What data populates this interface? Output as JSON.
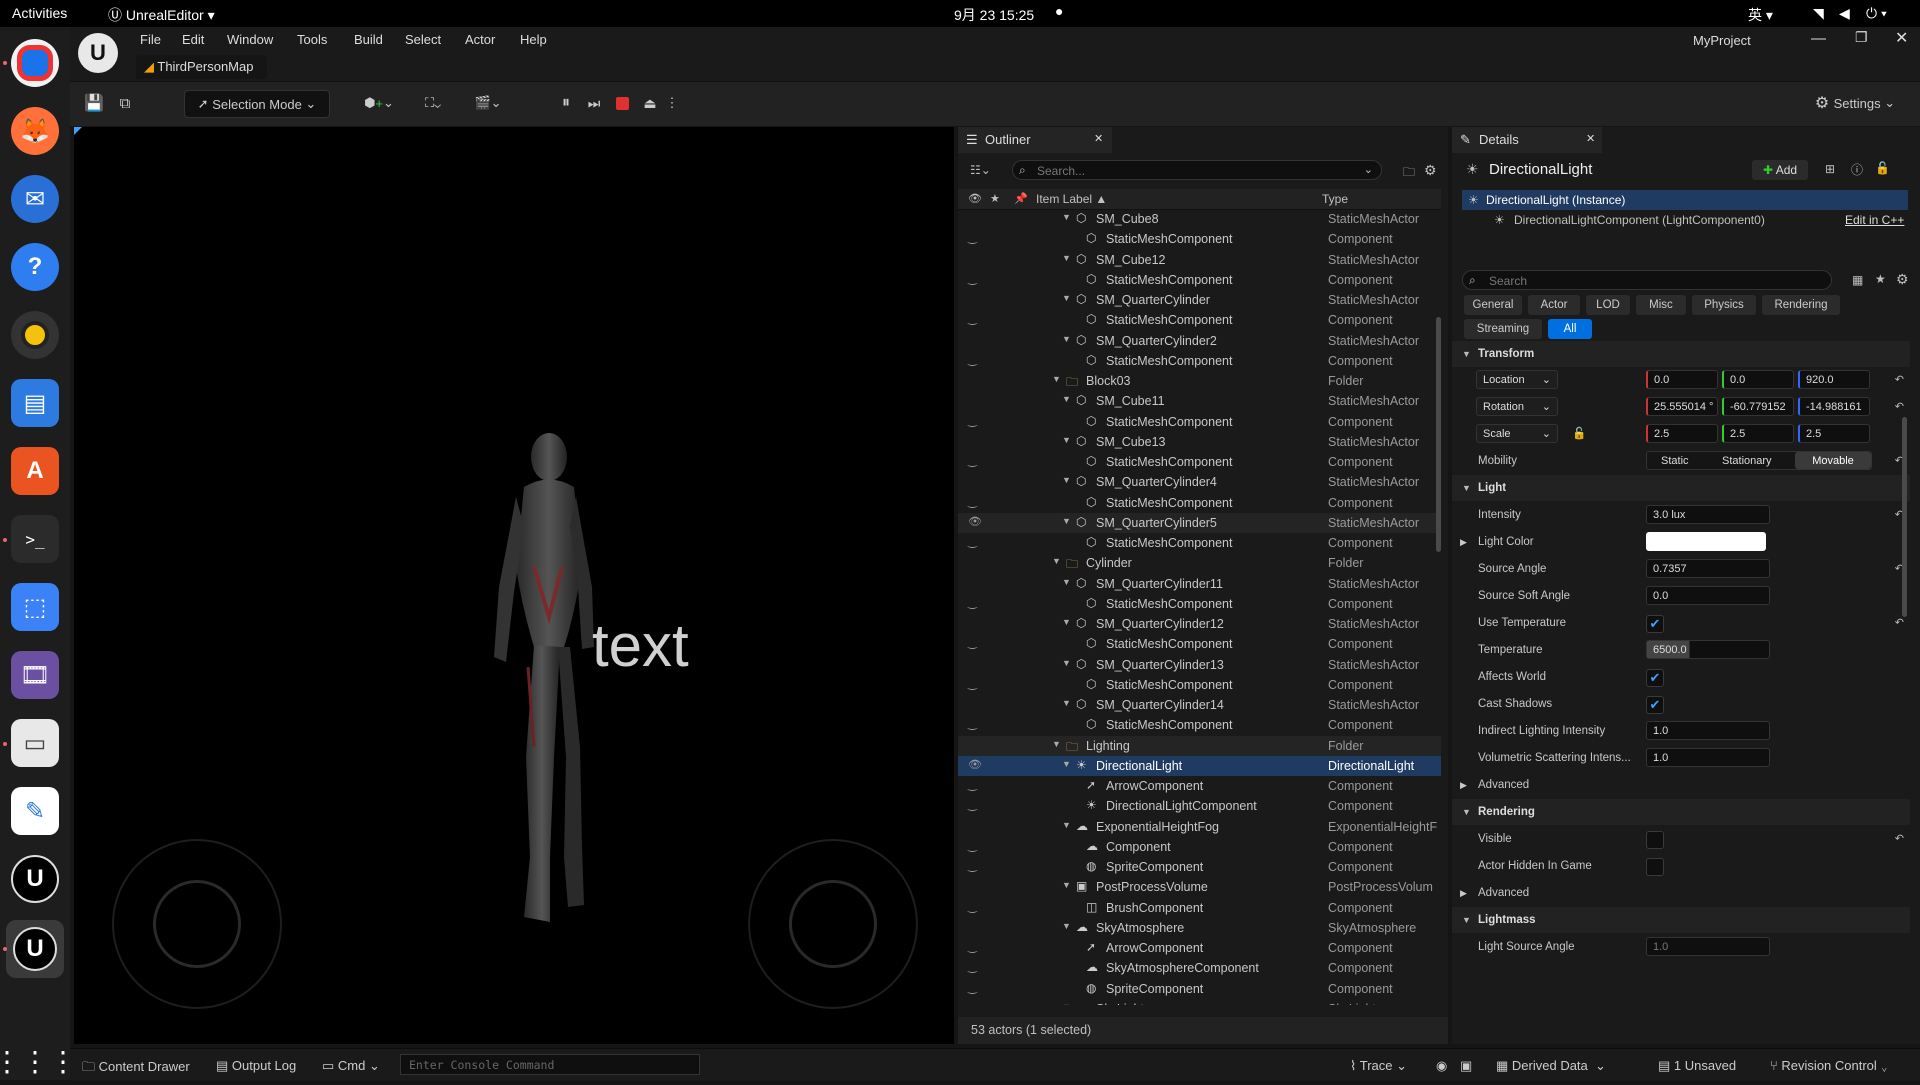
{
  "system": {
    "activities": "Activities",
    "app_name": "UnrealEditor",
    "datetime": "9月 23  15:25",
    "input_method": "英"
  },
  "window": {
    "menu": [
      "File",
      "Edit",
      "Window",
      "Tools",
      "Build",
      "Select",
      "Actor",
      "Help"
    ],
    "project": "MyProject",
    "map_tab": "ThirdPersonMap"
  },
  "toolbar": {
    "selection_mode": "Selection Mode",
    "settings": "Settings"
  },
  "viewport": {
    "overlay_text": "text"
  },
  "outliner": {
    "tab": "Outliner",
    "search_placeholder": "Search...",
    "col_label": "Item Label",
    "col_type": "Type",
    "rows": [
      {
        "label": "SM_Cube8",
        "type": "StaticMeshActor",
        "icon": "mesh-actor-icon",
        "indent": 2,
        "expand": true,
        "eye": false
      },
      {
        "label": "StaticMeshComponent",
        "type": "Component",
        "icon": "mesh-component-icon",
        "indent": 3,
        "expand": false,
        "eye": true
      },
      {
        "label": "SM_Cube12",
        "type": "StaticMeshActor",
        "icon": "mesh-actor-icon",
        "indent": 2,
        "expand": true,
        "eye": false
      },
      {
        "label": "StaticMeshComponent",
        "type": "Component",
        "icon": "mesh-component-icon",
        "indent": 3,
        "expand": false,
        "eye": true
      },
      {
        "label": "SM_QuarterCylinder",
        "type": "StaticMeshActor",
        "icon": "mesh-actor-icon",
        "indent": 2,
        "expand": true,
        "eye": false
      },
      {
        "label": "StaticMeshComponent",
        "type": "Component",
        "icon": "mesh-component-icon",
        "indent": 3,
        "expand": false,
        "eye": true
      },
      {
        "label": "SM_QuarterCylinder2",
        "type": "StaticMeshActor",
        "icon": "mesh-actor-icon",
        "indent": 2,
        "expand": true,
        "eye": false
      },
      {
        "label": "StaticMeshComponent",
        "type": "Component",
        "icon": "mesh-component-icon",
        "indent": 3,
        "expand": false,
        "eye": true
      },
      {
        "label": "Block03",
        "type": "Folder",
        "icon": "folder-icon",
        "indent": 1,
        "expand": true,
        "eye": false
      },
      {
        "label": "SM_Cube11",
        "type": "StaticMeshActor",
        "icon": "mesh-actor-icon",
        "indent": 2,
        "expand": true,
        "eye": false
      },
      {
        "label": "StaticMeshComponent",
        "type": "Component",
        "icon": "mesh-component-icon",
        "indent": 3,
        "expand": false,
        "eye": true
      },
      {
        "label": "SM_Cube13",
        "type": "StaticMeshActor",
        "icon": "mesh-actor-icon",
        "indent": 2,
        "expand": true,
        "eye": false
      },
      {
        "label": "StaticMeshComponent",
        "type": "Component",
        "icon": "mesh-component-icon",
        "indent": 3,
        "expand": false,
        "eye": true
      },
      {
        "label": "SM_QuarterCylinder4",
        "type": "StaticMeshActor",
        "icon": "mesh-actor-icon",
        "indent": 2,
        "expand": true,
        "eye": false
      },
      {
        "label": "StaticMeshComponent",
        "type": "Component",
        "icon": "mesh-component-icon",
        "indent": 3,
        "expand": false,
        "eye": true
      },
      {
        "label": "SM_QuarterCylinder5",
        "type": "StaticMeshActor",
        "icon": "mesh-actor-icon",
        "indent": 2,
        "expand": true,
        "eye": true,
        "hover": true
      },
      {
        "label": "StaticMeshComponent",
        "type": "Component",
        "icon": "mesh-component-icon",
        "indent": 3,
        "expand": false,
        "eye": true
      },
      {
        "label": "Cylinder",
        "type": "Folder",
        "icon": "folder-icon",
        "indent": 1,
        "expand": true,
        "eye": false
      },
      {
        "label": "SM_QuarterCylinder11",
        "type": "StaticMeshActor",
        "icon": "mesh-actor-icon",
        "indent": 2,
        "expand": true,
        "eye": false
      },
      {
        "label": "StaticMeshComponent",
        "type": "Component",
        "icon": "mesh-component-icon",
        "indent": 3,
        "expand": false,
        "eye": true
      },
      {
        "label": "SM_QuarterCylinder12",
        "type": "StaticMeshActor",
        "icon": "mesh-actor-icon",
        "indent": 2,
        "expand": true,
        "eye": false
      },
      {
        "label": "StaticMeshComponent",
        "type": "Component",
        "icon": "mesh-component-icon",
        "indent": 3,
        "expand": false,
        "eye": true
      },
      {
        "label": "SM_QuarterCylinder13",
        "type": "StaticMeshActor",
        "icon": "mesh-actor-icon",
        "indent": 2,
        "expand": true,
        "eye": false
      },
      {
        "label": "StaticMeshComponent",
        "type": "Component",
        "icon": "mesh-component-icon",
        "indent": 3,
        "expand": false,
        "eye": true
      },
      {
        "label": "SM_QuarterCylinder14",
        "type": "StaticMeshActor",
        "icon": "mesh-actor-icon",
        "indent": 2,
        "expand": true,
        "eye": false
      },
      {
        "label": "StaticMeshComponent",
        "type": "Component",
        "icon": "mesh-component-icon",
        "indent": 3,
        "expand": false,
        "eye": true
      },
      {
        "label": "Lighting",
        "type": "Folder",
        "icon": "folder-icon",
        "indent": 1,
        "expand": true,
        "eye": false,
        "hover": true
      },
      {
        "label": "DirectionalLight",
        "type": "DirectionalLight",
        "icon": "sun-icon",
        "indent": 2,
        "expand": true,
        "eye": true,
        "selected": true
      },
      {
        "label": "ArrowComponent",
        "type": "Component",
        "icon": "arrow-icon",
        "indent": 3,
        "expand": false,
        "eye": true
      },
      {
        "label": "DirectionalLightComponent",
        "type": "Component",
        "icon": "sun-icon",
        "indent": 3,
        "expand": false,
        "eye": true
      },
      {
        "label": "ExponentialHeightFog",
        "type": "ExponentialHeightF",
        "icon": "fog-icon",
        "indent": 2,
        "expand": true,
        "eye": false
      },
      {
        "label": "Component",
        "type": "Component",
        "icon": "fog-icon",
        "indent": 3,
        "expand": false,
        "eye": true
      },
      {
        "label": "SpriteComponent",
        "type": "Component",
        "icon": "sprite-icon",
        "indent": 3,
        "expand": false,
        "eye": true
      },
      {
        "label": "PostProcessVolume",
        "type": "PostProcessVolum",
        "icon": "volume-icon",
        "indent": 2,
        "expand": true,
        "eye": false
      },
      {
        "label": "BrushComponent",
        "type": "Component",
        "icon": "brush-icon",
        "indent": 3,
        "expand": false,
        "eye": true
      },
      {
        "label": "SkyAtmosphere",
        "type": "SkyAtmosphere",
        "icon": "sky-icon",
        "indent": 2,
        "expand": true,
        "eye": false
      },
      {
        "label": "ArrowComponent",
        "type": "Component",
        "icon": "arrow-icon",
        "indent": 3,
        "expand": false,
        "eye": true
      },
      {
        "label": "SkyAtmosphereComponent",
        "type": "Component",
        "icon": "sky-icon",
        "indent": 3,
        "expand": false,
        "eye": true
      },
      {
        "label": "SpriteComponent",
        "type": "Component",
        "icon": "sprite-icon",
        "indent": 3,
        "expand": false,
        "eye": true
      },
      {
        "label": "SkyLight",
        "type": "SkyLight",
        "icon": "skylight-icon",
        "indent": 2,
        "expand": true,
        "eye": false
      }
    ],
    "footer": "53 actors (1 selected)"
  },
  "details": {
    "tab": "Details",
    "actor_name": "DirectionalLight",
    "add_label": "Add",
    "instance_label": "DirectionalLight (Instance)",
    "component_label": "DirectionalLightComponent (LightComponent0)",
    "edit_cpp": "Edit in C++",
    "search_placeholder": "Search",
    "categories": [
      "General",
      "Actor",
      "LOD",
      "Misc",
      "Physics",
      "Rendering",
      "Streaming",
      "All"
    ],
    "transform": {
      "section": "Transform",
      "location_label": "Location",
      "location": [
        "0.0",
        "0.0",
        "920.0"
      ],
      "rotation_label": "Rotation",
      "rotation": [
        "25.555014 °",
        "-60.779152",
        "-14.988161"
      ],
      "scale_label": "Scale",
      "scale": [
        "2.5",
        "2.5",
        "2.5"
      ],
      "mobility_label": "Mobility",
      "mobility_options": [
        "Static",
        "Stationary",
        "Movable"
      ]
    },
    "light": {
      "section": "Light",
      "intensity_label": "Intensity",
      "intensity": "3.0 lux",
      "light_color_label": "Light Color",
      "light_color": "#ffffff",
      "source_angle_label": "Source Angle",
      "source_angle": "0.7357",
      "source_soft_angle_label": "Source Soft Angle",
      "source_soft_angle": "0.0",
      "use_temperature_label": "Use Temperature",
      "temperature_label": "Temperature",
      "temperature": "6500.0",
      "affects_world_label": "Affects World",
      "cast_shadows_label": "Cast Shadows",
      "indirect_label": "Indirect Lighting Intensity",
      "indirect": "1.0",
      "volumetric_label": "Volumetric Scattering Intens...",
      "volumetric": "1.0",
      "advanced": "Advanced"
    },
    "rendering": {
      "section": "Rendering",
      "visible_label": "Visible",
      "hidden_label": "Actor Hidden In Game",
      "advanced": "Advanced"
    },
    "lightmass": {
      "section": "Lightmass",
      "light_source_angle_label": "Light Source Angle",
      "light_source_angle": "1.0"
    }
  },
  "statusbar": {
    "content_drawer": "Content Drawer",
    "output_log": "Output Log",
    "cmd": "Cmd",
    "console_placeholder": "Enter Console Command",
    "trace": "Trace",
    "derived_data": "Derived Data",
    "unsaved": "1 Unsaved",
    "revision_control": "Revision Control"
  },
  "colors": {
    "accent": "#0070e0",
    "selection": "#1f3b62",
    "check": "#3ea1ff"
  }
}
